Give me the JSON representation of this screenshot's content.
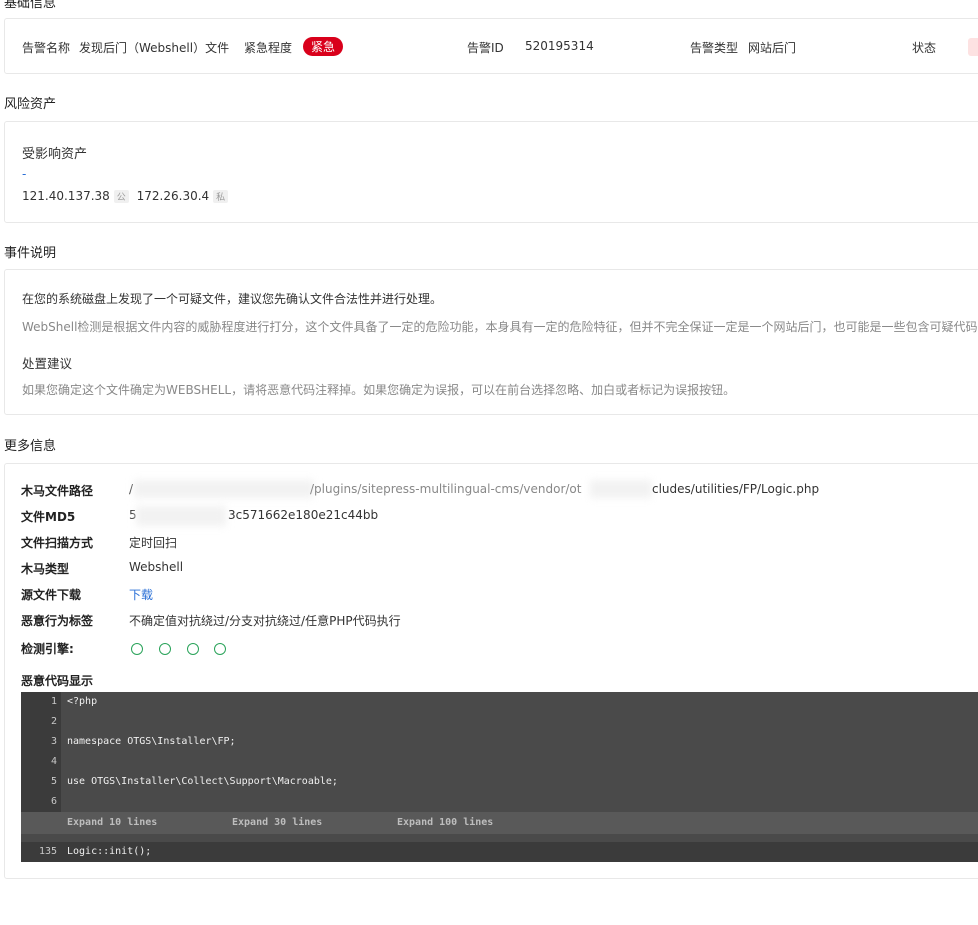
{
  "sections": {
    "basic": "基础信息",
    "risk": "风险资产",
    "event": "事件说明",
    "more": "更多信息"
  },
  "basic": {
    "alert_name_label": "告警名称",
    "alert_name_value": "发现后门（Webshell）文件",
    "urgency_label": "紧急程度",
    "urgency_value": "紧急",
    "alert_id_label": "告警ID",
    "alert_id_value": "520195314",
    "alert_type_label": "告警类型",
    "alert_type_value": "网站后门",
    "status_label": "状态"
  },
  "risk": {
    "affected_label": "受影响资产",
    "dash": "-",
    "ip_public": "121.40.137.38",
    "ip_public_tag": "公",
    "ip_private": "172.26.30.4",
    "ip_private_tag": "私"
  },
  "event": {
    "summary": "在您的系统磁盘上发现了一个可疑文件，建议您先确认文件合法性并进行处理。",
    "detail": "WebShell检测是根据文件内容的威胁程度进行打分，这个文件具备了一定的危险功能，本身具有一定的危险特征，但并不完全保证一定是一个网站后门，也可能是一些包含可疑代码的",
    "advice_title": "处置建议",
    "advice": "如果您确定这个文件确定为WEBSHELL，请将恶意代码注释掉。如果您确定为误报，可以在前台选择忽略、加白或者标记为误报按钮。"
  },
  "more": {
    "path_label": "木马文件路径",
    "path_value_a": "/",
    "path_value_b": "/plugins/sitepress-multilingual-cms/vendor/ot",
    "path_value_c": "cludes/utilities/FP/Logic.php",
    "md5_label": "文件MD5",
    "md5_value_a": "5",
    "md5_value_b": "3c571662e180e21c44bb",
    "scan_label": "文件扫描方式",
    "scan_value": "定时回扫",
    "trojan_type_label": "木马类型",
    "trojan_type_value": "Webshell",
    "download_label": "源文件下载",
    "download_value": "下载",
    "behavior_label": "恶意行为标签",
    "behavior_value": "不确定值对抗绕过/分支对抗绕过/任意PHP代码执行",
    "engine_label": "检测引擎:",
    "code_label": "恶意代码显示"
  },
  "code": {
    "lines": [
      {
        "n": "1",
        "text": "<?php"
      },
      {
        "n": "2",
        "text": ""
      },
      {
        "n": "3",
        "text": "namespace OTGS\\Installer\\FP;"
      },
      {
        "n": "4",
        "text": ""
      },
      {
        "n": "5",
        "text": "use OTGS\\Installer\\Collect\\Support\\Macroable;"
      },
      {
        "n": "6",
        "text": ""
      }
    ],
    "expand_10": "Expand 10 lines",
    "expand_30": "Expand 30 lines",
    "expand_100": "Expand 100 lines",
    "last_n": "135",
    "last_text": "Logic::init();"
  },
  "colors": {
    "urgent": "#d9001b",
    "link": "#2a6fd6",
    "engine_icon": "#2aa35a"
  }
}
